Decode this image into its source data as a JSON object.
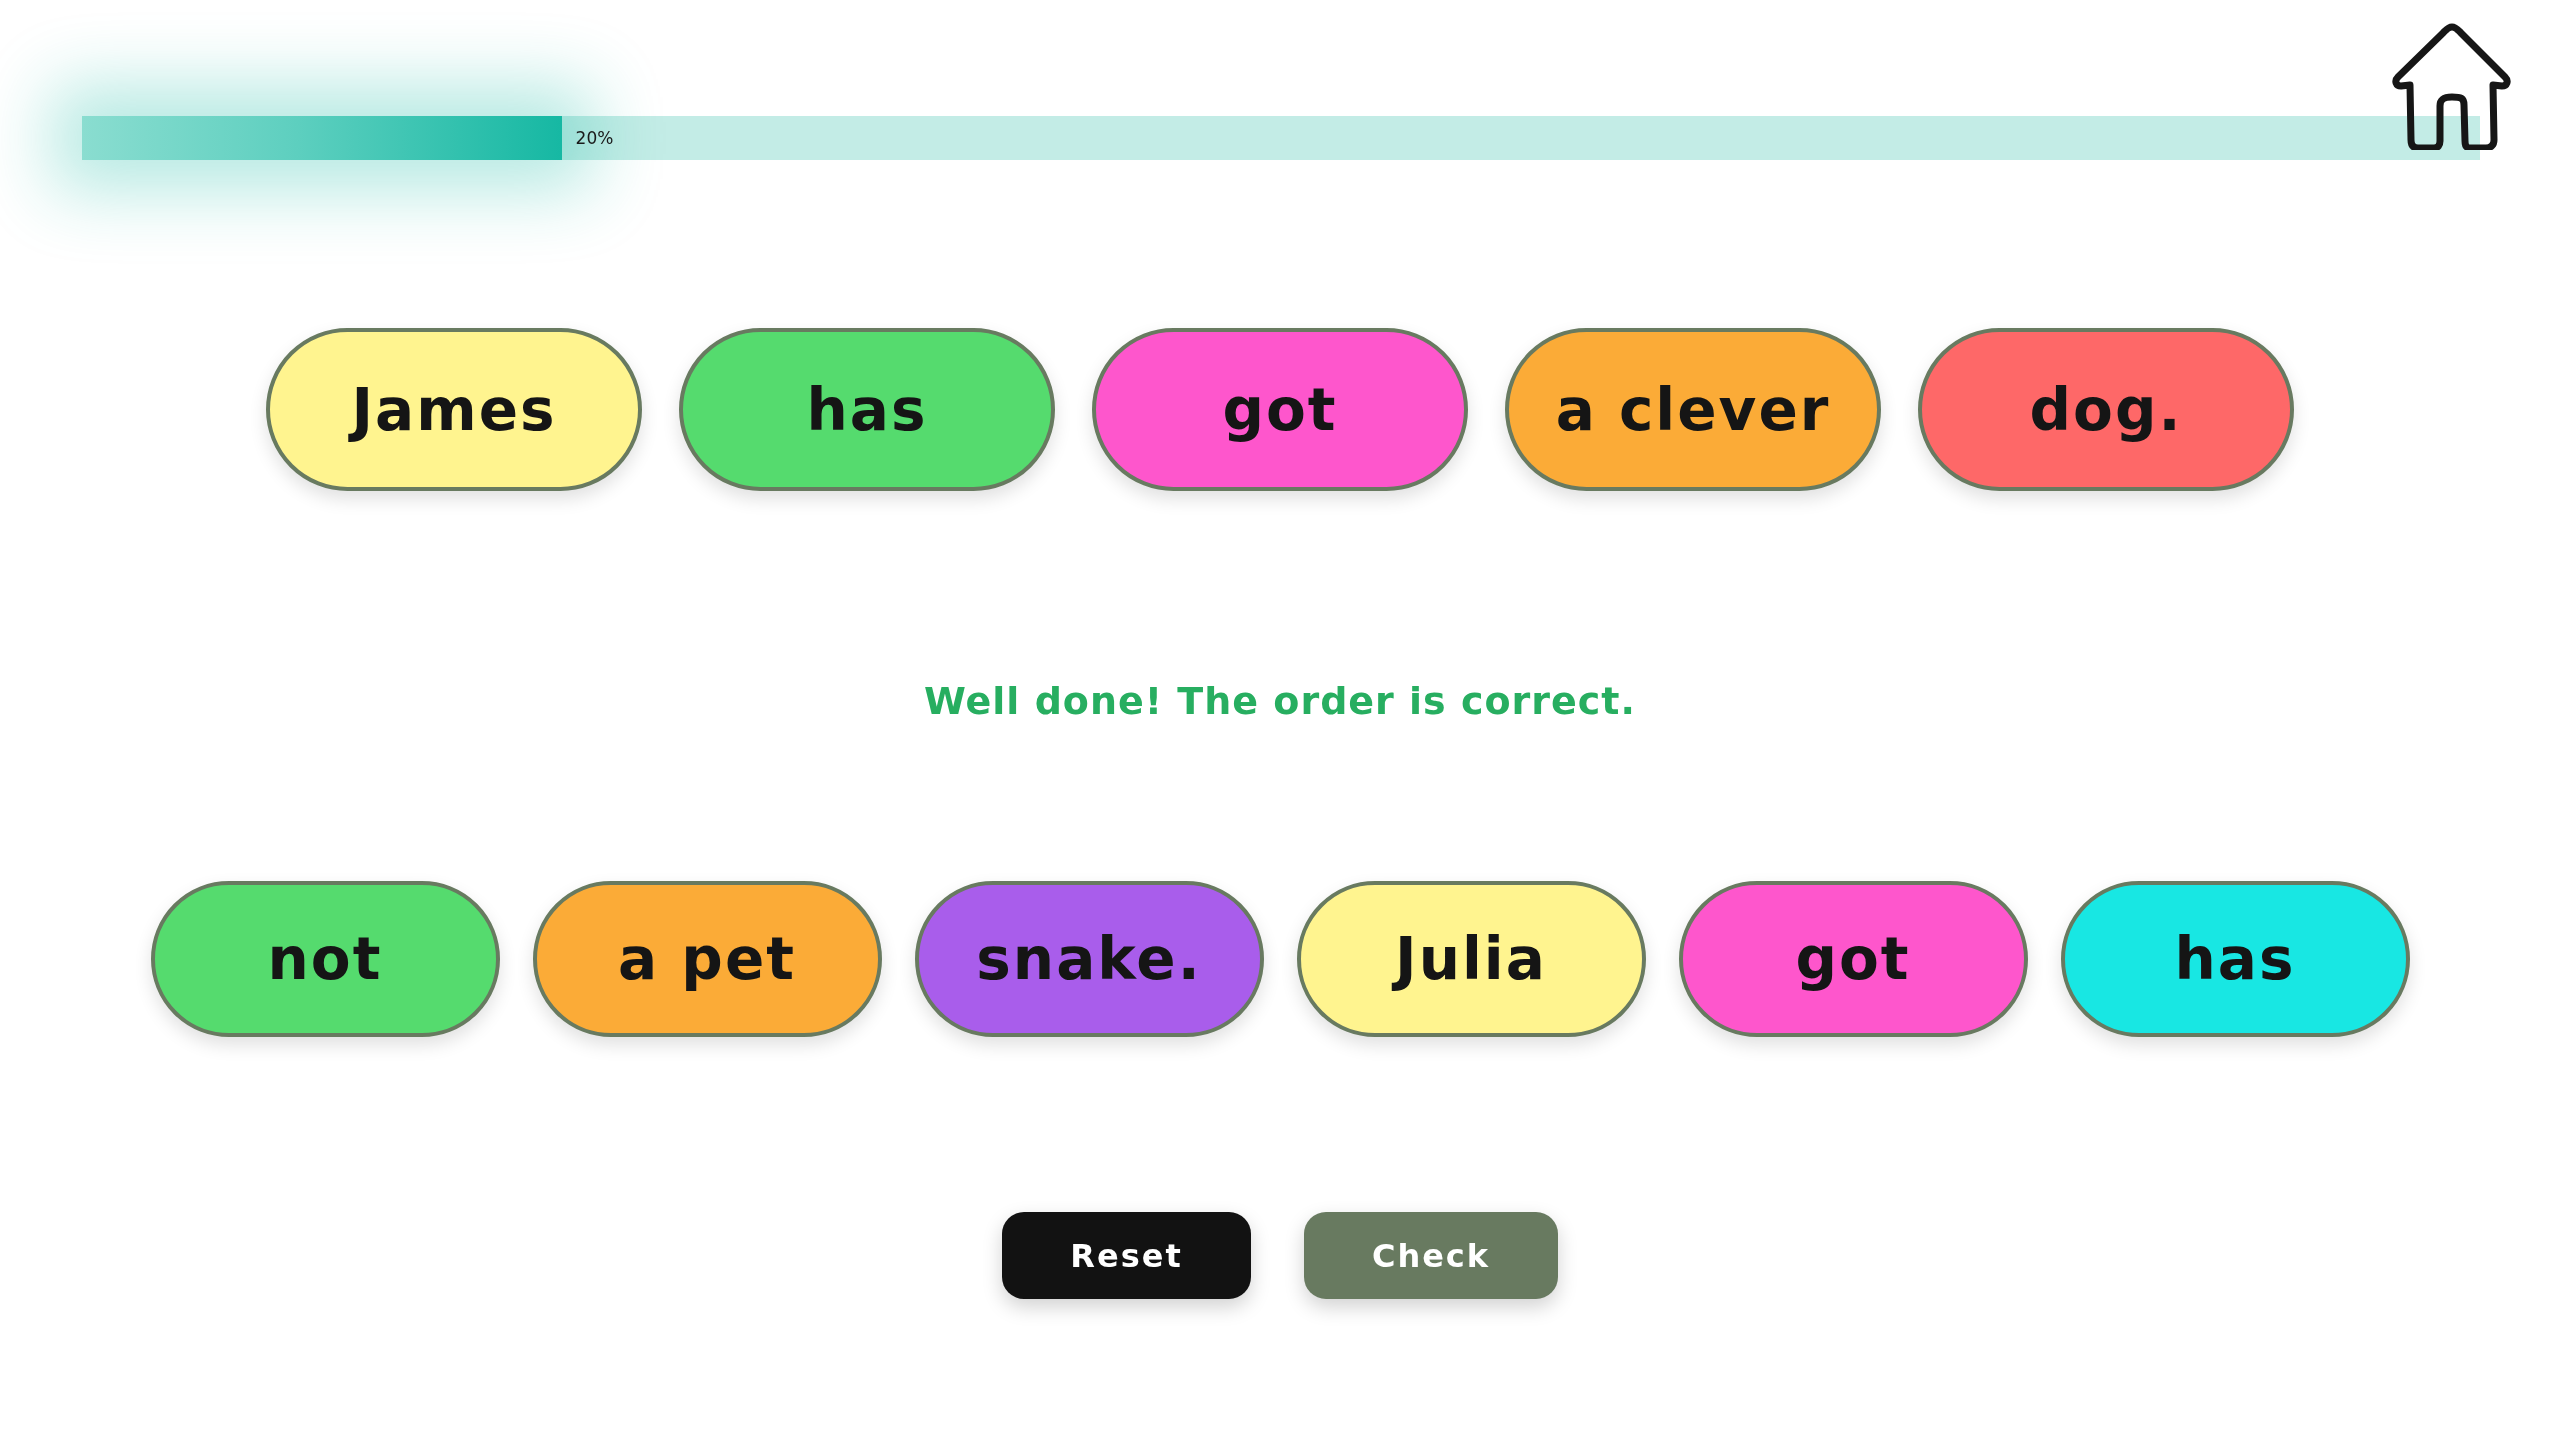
{
  "progress": {
    "level": 0.2,
    "label": "20%"
  },
  "answer_row": [
    {
      "text": "James",
      "color": "#fff48f"
    },
    {
      "text": "has",
      "color": "#55db6e"
    },
    {
      "text": "got",
      "color": "#fe56cc"
    },
    {
      "text": "a clever",
      "color": "#fbab37"
    },
    {
      "text": "dog.",
      "color": "#fe6868"
    }
  ],
  "feedback": {
    "text": "Well done! The order is correct.",
    "kind": "success"
  },
  "word_bank": [
    {
      "text": "not",
      "color": "#55db6e"
    },
    {
      "text": "a pet",
      "color": "#fbab37"
    },
    {
      "text": "snake.",
      "color": "#a95deb"
    },
    {
      "text": "Julia",
      "color": "#fff48f"
    },
    {
      "text": "got",
      "color": "#fe56cc"
    },
    {
      "text": "has",
      "color": "#18e7e3"
    }
  ],
  "buttons": [
    {
      "label": "Reset",
      "kind": "dark"
    },
    {
      "label": "Check",
      "kind": "muted"
    }
  ]
}
